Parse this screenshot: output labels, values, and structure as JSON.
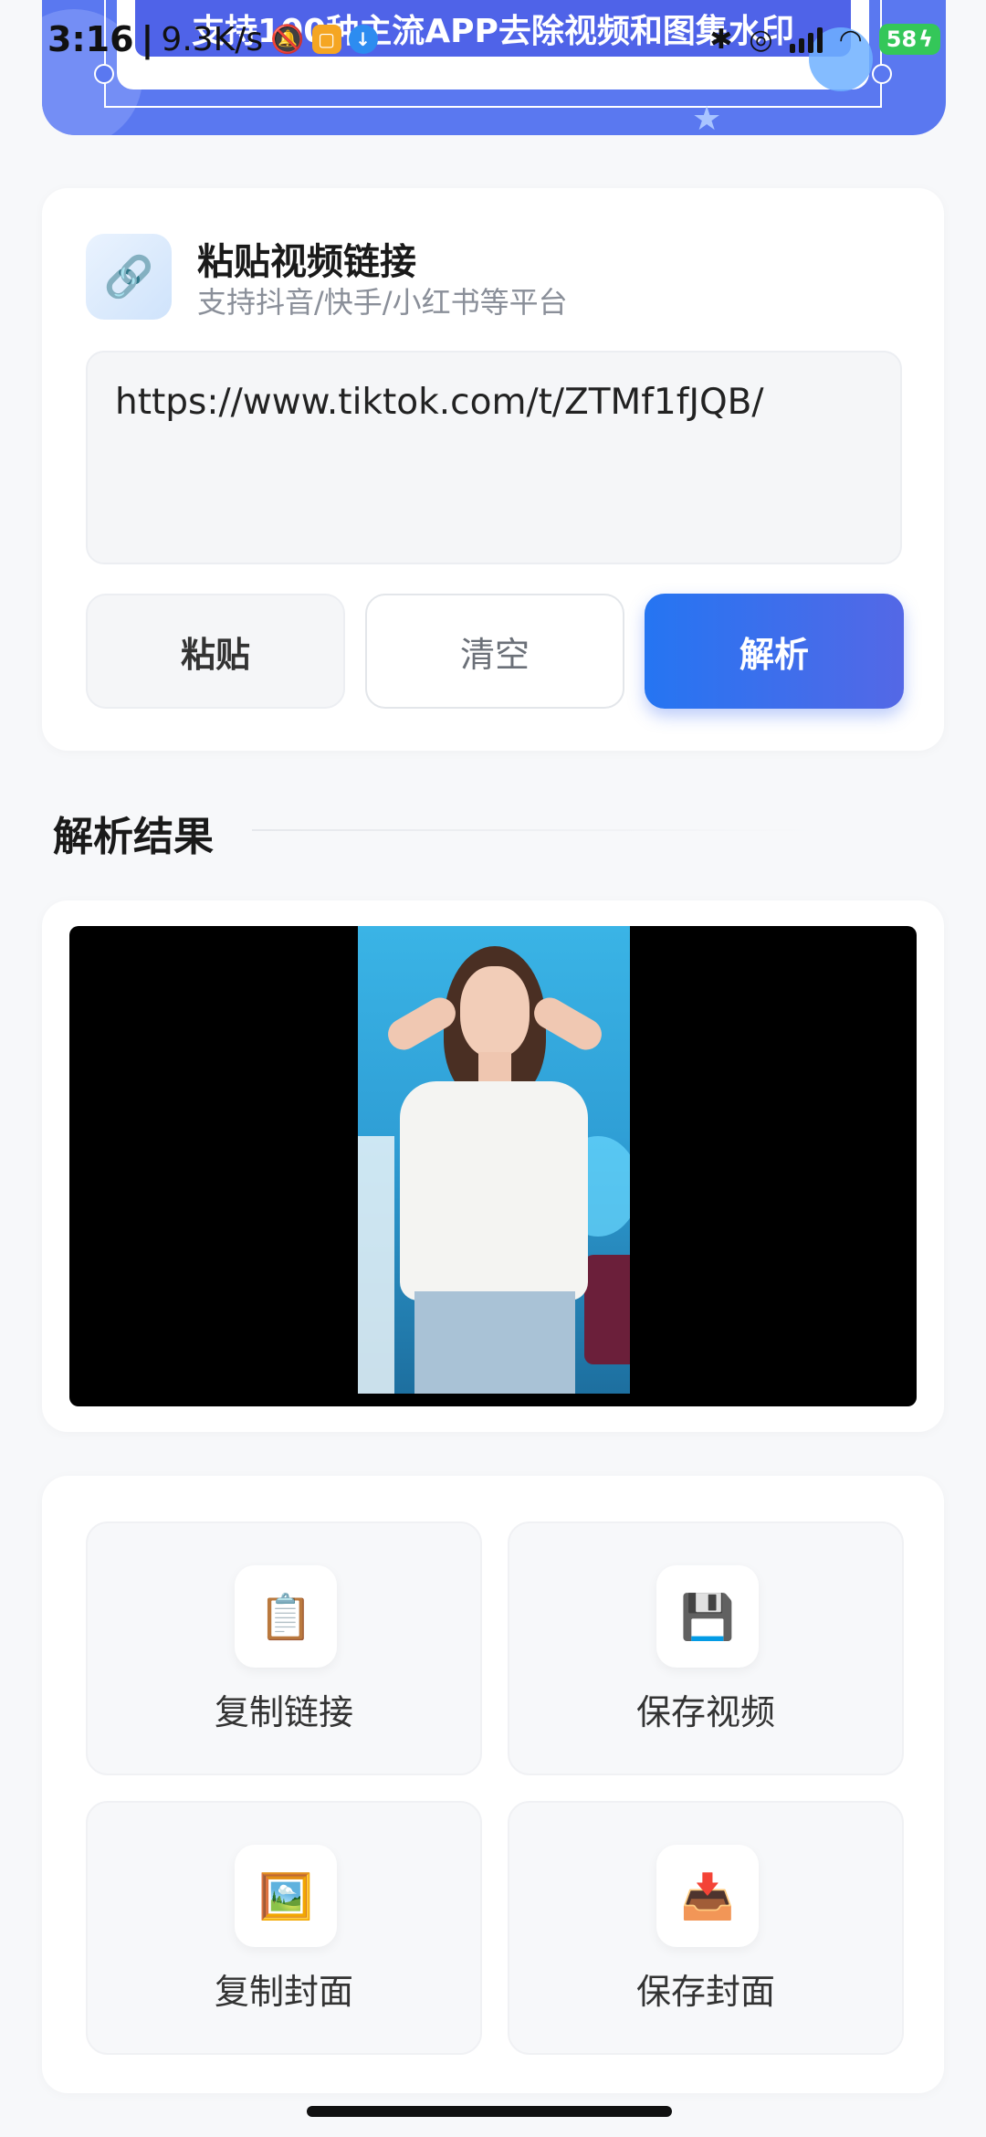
{
  "banner": {
    "text": "支持100种主流APP去除视频和图集水印"
  },
  "status_bar": {
    "time": "3:16",
    "speed": "9.3K/s",
    "battery": "58"
  },
  "input_card": {
    "title": "粘贴视频链接",
    "subtitle": "支持抖音/快手/小红书等平台",
    "url_value": "https://www.tiktok.com/t/ZTMf1fJQB/",
    "buttons": {
      "paste": "粘贴",
      "clear": "清空",
      "parse": "解析"
    }
  },
  "result_section": {
    "title": "解析结果"
  },
  "actions": [
    {
      "label": "复制链接",
      "icon": "📋"
    },
    {
      "label": "保存视频",
      "icon": "💾"
    },
    {
      "label": "复制封面",
      "icon": "🖼️"
    },
    {
      "label": "保存封面",
      "icon": "📥"
    }
  ],
  "colors": {
    "accent": "#2575f2",
    "banner": "#5a78f0",
    "page_bg": "#f7f8fa"
  }
}
